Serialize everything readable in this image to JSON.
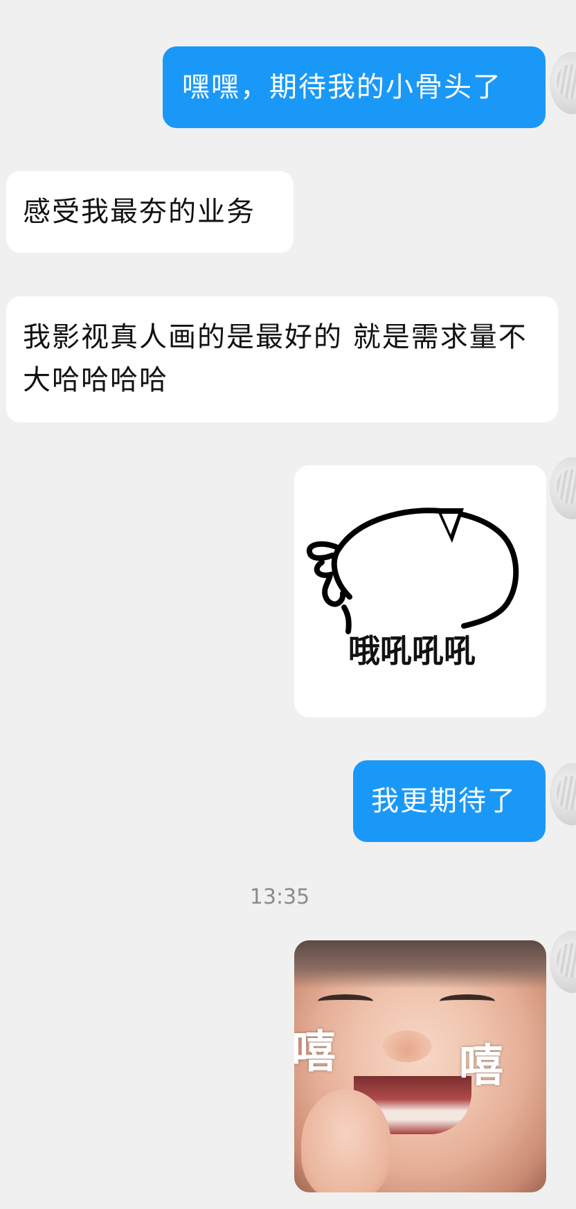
{
  "messages": [
    {
      "id": "m1",
      "direction": "outgoing",
      "text": "嘿嘿，期待我的小骨头了"
    },
    {
      "id": "m2",
      "direction": "incoming",
      "text": "感受我最夯的业务"
    },
    {
      "id": "m3",
      "direction": "incoming",
      "text": "我影视真人画的是最好的 就是需求量不大哈哈哈哈"
    },
    {
      "id": "m4",
      "direction": "outgoing",
      "type": "sticker",
      "caption": "哦吼吼吼"
    },
    {
      "id": "m5",
      "direction": "outgoing",
      "text": "我更期待了"
    },
    {
      "id": "m6",
      "direction": "outgoing",
      "type": "photo-sticker",
      "left_text": "嘻",
      "right_text": "嘻"
    }
  ],
  "timestamp": "13:35",
  "colors": {
    "outgoing_bubble": "#1a98f8",
    "incoming_bubble": "#ffffff",
    "background": "#f0f0f0",
    "timestamp_text": "#8b8b8b"
  }
}
